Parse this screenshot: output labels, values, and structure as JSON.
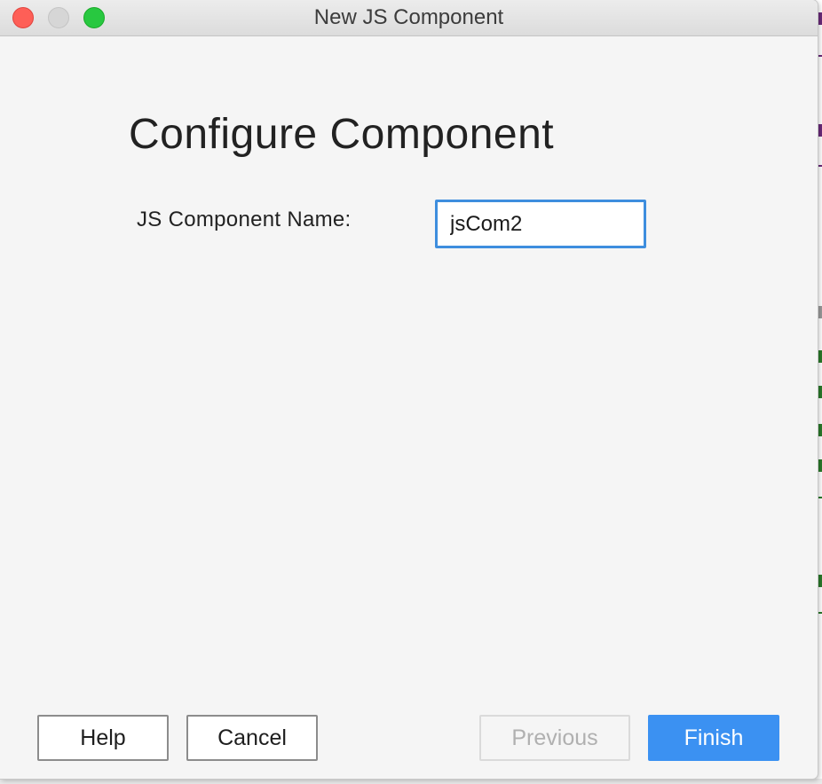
{
  "window": {
    "title": "New JS Component"
  },
  "content": {
    "heading": "Configure Component",
    "name_label": "JS Component Name:",
    "name_value": "jsCom2"
  },
  "buttons": {
    "help": "Help",
    "cancel": "Cancel",
    "previous": "Previous",
    "finish": "Finish"
  },
  "colors": {
    "accent": "#3b91f2",
    "focus_ring": "#3e8ede",
    "close": "#fe5f57",
    "zoom": "#28c840"
  },
  "icons": {
    "close": "close-window-icon",
    "minimize": "minimize-window-icon",
    "zoom": "zoom-window-icon"
  }
}
